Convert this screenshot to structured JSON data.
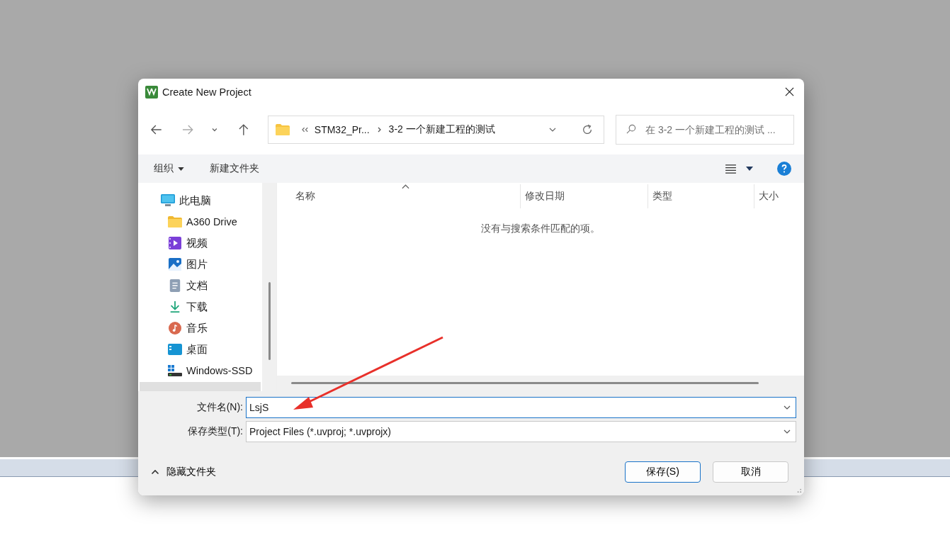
{
  "window": {
    "title": "Create New Project"
  },
  "address": {
    "segments": [
      "STM32_Pr...",
      "3-2 一个新建工程的测试"
    ]
  },
  "search": {
    "placeholder": "在 3-2 一个新建工程的测试 ..."
  },
  "toolbar": {
    "items": [
      "组织",
      "新建文件夹"
    ]
  },
  "sidebar": {
    "items": [
      {
        "label": "此电脑",
        "children": [
          {
            "label": "A360 Drive"
          },
          {
            "label": "视频"
          },
          {
            "label": "图片"
          },
          {
            "label": "文档"
          },
          {
            "label": "下载"
          },
          {
            "label": "音乐"
          },
          {
            "label": "桌面"
          },
          {
            "label": "Windows-SSD"
          }
        ]
      }
    ]
  },
  "table": {
    "columns": [
      "名称",
      "修改日期",
      "类型",
      "大小"
    ],
    "empty_message": "没有与搜索条件匹配的项。"
  },
  "form": {
    "fields": [
      {
        "label": "文件名(N):",
        "value": "LsjS"
      },
      {
        "label": "保存类型(T):",
        "value": "Project Files (*.uvproj; *.uvprojx)"
      }
    ]
  },
  "footer": {
    "toggle": "隐藏文件夹",
    "buttons": [
      {
        "label": "保存(S)",
        "default": true
      },
      {
        "label": "取消",
        "default": false
      }
    ]
  }
}
